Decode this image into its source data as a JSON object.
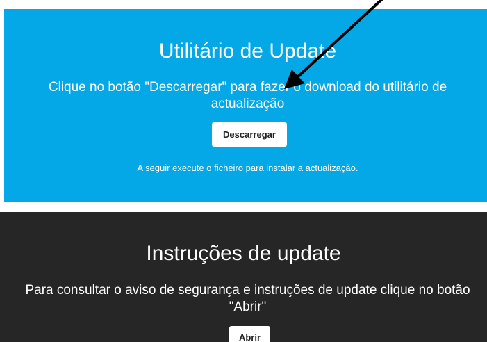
{
  "update_section": {
    "title": "Utilitário de Update",
    "description": "Clique no botão \"Descarregar\" para fazer o download do utilitário de actualização",
    "button_label": "Descarregar",
    "note": "A seguir execute o ficheiro para instalar a actualização.",
    "background_color": "#04a8e6"
  },
  "instructions_section": {
    "title": "Instruções de update",
    "description_line1": "Para consultar o aviso de segurança e instruções de update clique no botão",
    "description_line2": "\"Abrir\"",
    "button_label": "Abrir",
    "background_color": "#262626"
  },
  "annotation": {
    "icon": "arrow-pointer-icon",
    "color": "#000000"
  }
}
